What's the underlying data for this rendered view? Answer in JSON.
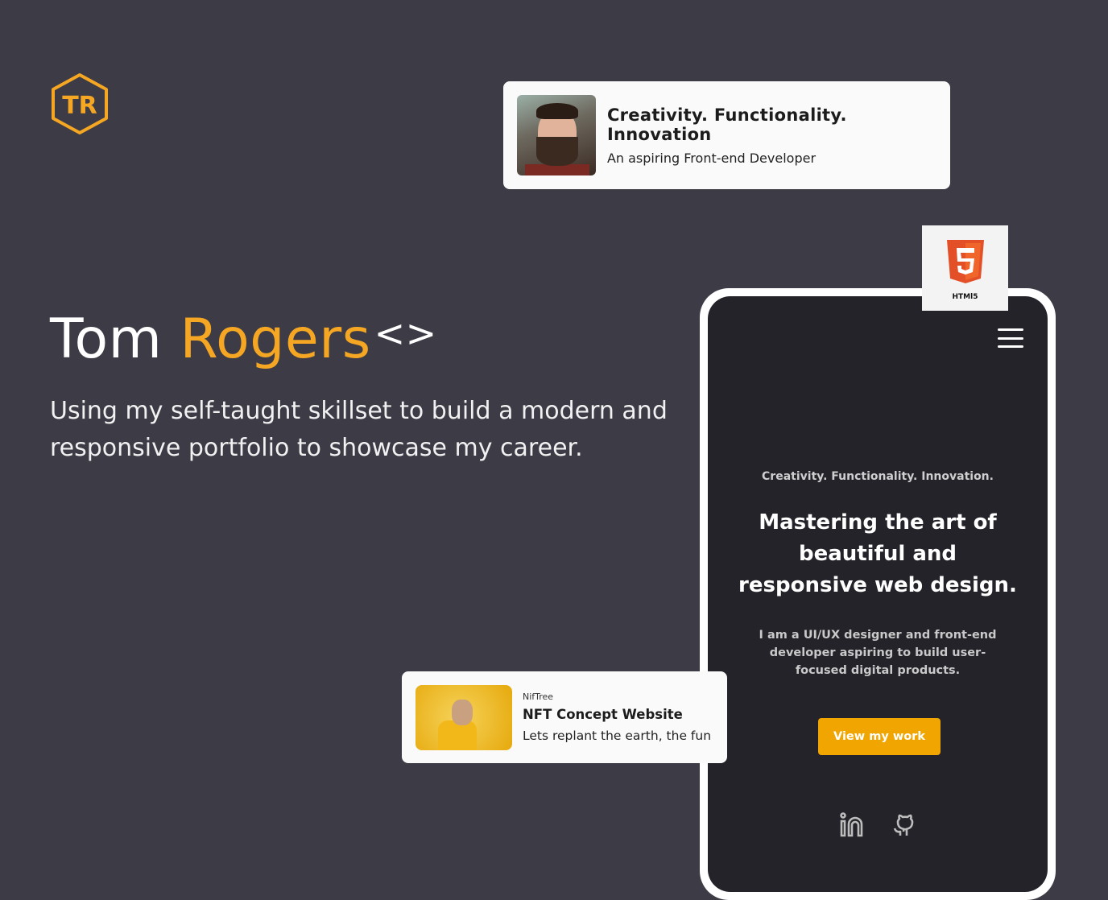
{
  "logo": {
    "text": "TR",
    "color": "#f5a623"
  },
  "hero": {
    "first_name": "Tom",
    "last_name": "Rogers",
    "code_symbol": "<>",
    "description": "Using my self-taught skillset to build a modern and responsive portfolio to showcase my career."
  },
  "profile_card": {
    "title": "Creativity. Functionality. Innovation",
    "subtitle": "An aspiring Front-end Developer"
  },
  "badge": {
    "label": "HTMl5",
    "color": "#e34f26"
  },
  "phone": {
    "tagline": "Creativity.  Functionality. Innovation.",
    "headline": "Mastering the art of beautiful and responsive web design.",
    "description": "I am a UI/UX designer and front-end developer aspiring to build user-focused digital products.",
    "cta": "View my work",
    "cta_color": "#f0a500",
    "socials": [
      "linkedin-icon",
      "github-icon"
    ]
  },
  "project_card": {
    "client": "NifTree",
    "title": "NFT Concept Website",
    "description": "Lets replant the earth, the fun"
  }
}
